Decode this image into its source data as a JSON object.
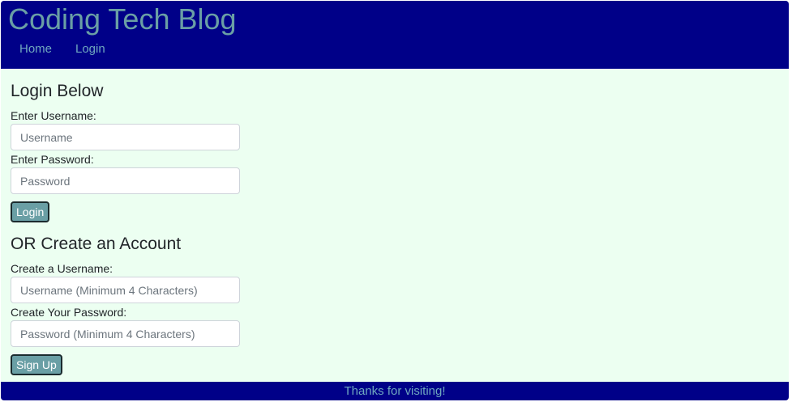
{
  "header": {
    "site_title": "Coding Tech Blog",
    "nav": {
      "home": "Home",
      "login": "Login"
    }
  },
  "login_form": {
    "heading": "Login Below",
    "username_label": "Enter Username:",
    "username_placeholder": "Username",
    "username_value": "",
    "password_label": "Enter Password:",
    "password_placeholder": "Password",
    "password_value": "",
    "submit_label": "Login"
  },
  "signup_form": {
    "heading": "OR Create an Account",
    "username_label": "Create a Username:",
    "username_placeholder": "Username (Minimum 4 Characters)",
    "username_value": "",
    "password_label": "Create Your Password:",
    "password_placeholder": "Password (Minimum 4 Characters)",
    "password_value": "",
    "submit_label": "Sign Up"
  },
  "footer": {
    "text": "Thanks for visiting!"
  },
  "colors": {
    "header_bg": "#000088",
    "page_bg": "#ecfff1",
    "title": "#6a9fa5",
    "nav_link": "#6fa7bf",
    "button_bg": "#6a9fa5"
  }
}
